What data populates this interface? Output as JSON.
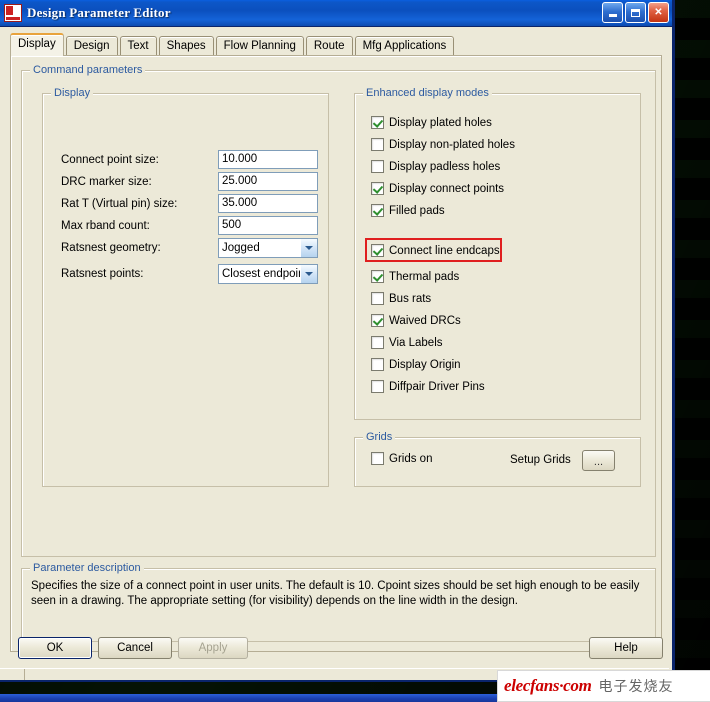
{
  "window": {
    "title": "Design Parameter Editor",
    "icon": "app-document-icon",
    "buttons": {
      "minimize": "minimize",
      "maximize": "maximize",
      "close": "✕"
    }
  },
  "tabs": [
    {
      "label": "Display",
      "active": true
    },
    {
      "label": "Design",
      "active": false
    },
    {
      "label": "Text",
      "active": false
    },
    {
      "label": "Shapes",
      "active": false
    },
    {
      "label": "Flow Planning",
      "active": false
    },
    {
      "label": "Route",
      "active": false
    },
    {
      "label": "Mfg Applications",
      "active": false
    }
  ],
  "command_parameters": {
    "title": "Command parameters",
    "display_group": {
      "title": "Display",
      "fields": [
        {
          "label": "Connect point size:",
          "value": "10.000",
          "type": "text"
        },
        {
          "label": "DRC marker size:",
          "value": "25.000",
          "type": "text"
        },
        {
          "label": "Rat T (Virtual pin) size:",
          "value": "35.000",
          "type": "text"
        },
        {
          "label": "Max rband count:",
          "value": "500",
          "type": "text"
        },
        {
          "label": "Ratsnest geometry:",
          "value": "Jogged",
          "type": "select"
        },
        {
          "label": "Ratsnest points:",
          "value": "Closest endpoint",
          "type": "select"
        }
      ]
    },
    "enhanced_group": {
      "title": "Enhanced display modes",
      "checkboxes": [
        {
          "label": "Display plated holes",
          "checked": true,
          "highlighted": false
        },
        {
          "label": "Display non-plated holes",
          "checked": false,
          "highlighted": false
        },
        {
          "label": "Display padless holes",
          "checked": false,
          "highlighted": false
        },
        {
          "label": "Display connect points",
          "checked": true,
          "highlighted": false
        },
        {
          "label": "Filled pads",
          "checked": true,
          "highlighted": false
        },
        {
          "label": "Connect line endcaps",
          "checked": true,
          "highlighted": true
        },
        {
          "label": "Thermal pads",
          "checked": true,
          "highlighted": false
        },
        {
          "label": "Bus rats",
          "checked": false,
          "highlighted": false
        },
        {
          "label": "Waived DRCs",
          "checked": true,
          "highlighted": false
        },
        {
          "label": "Via Labels",
          "checked": false,
          "highlighted": false
        },
        {
          "label": "Display Origin",
          "checked": false,
          "highlighted": false
        },
        {
          "label": "Diffpair Driver Pins",
          "checked": false,
          "highlighted": false
        }
      ],
      "highlight_color": "#e01f1f"
    },
    "grids_group": {
      "title": "Grids",
      "checkbox": {
        "label": "Grids on",
        "checked": false
      },
      "setup_label": "Setup Grids",
      "setup_button": "..."
    }
  },
  "parameter_description": {
    "title": "Parameter description",
    "text": "Specifies the size of a connect point in user units. The default is 10. Cpoint sizes should be set high enough to be easily seen in a drawing. The appropriate setting (for visibility) depends on the line width in the design."
  },
  "footer": {
    "ok": "OK",
    "cancel": "Cancel",
    "apply": "Apply",
    "help": "Help"
  },
  "watermark": {
    "latin": "elecfans·com",
    "chinese": "电子发烧友"
  }
}
